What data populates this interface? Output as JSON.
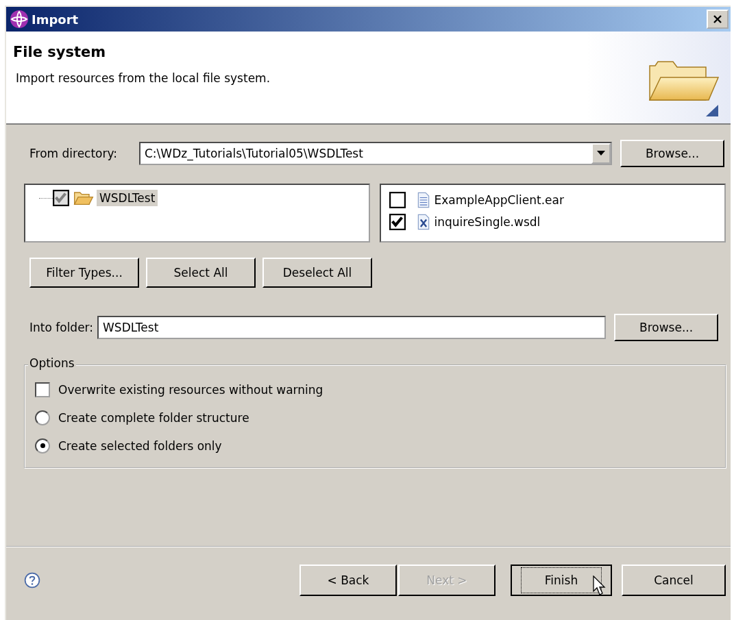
{
  "window": {
    "title": "Import"
  },
  "header": {
    "title": "File system",
    "description": "Import resources from the local file system."
  },
  "from_directory": {
    "label": "From directory:",
    "value": "C:\\WDz_Tutorials\\Tutorial05\\WSDLTest",
    "browse": "Browse..."
  },
  "folder_tree": [
    {
      "label": "WSDLTest",
      "checked": true,
      "grayed": true,
      "selected": true
    }
  ],
  "file_list": [
    {
      "label": "ExampleAppClient.ear",
      "checked": false,
      "kind": "text"
    },
    {
      "label": "inquireSingle.wsdl",
      "checked": true,
      "kind": "xml"
    }
  ],
  "selection_buttons": [
    "Filter Types...",
    "Select All",
    "Deselect All"
  ],
  "into_folder": {
    "label": "Into folder:",
    "value": "WSDLTest",
    "browse": "Browse..."
  },
  "options": {
    "title": "Options",
    "items": [
      {
        "kind": "checkbox",
        "label": "Overwrite existing resources without warning",
        "checked": false
      },
      {
        "kind": "radio",
        "label": "Create complete folder structure",
        "selected": false
      },
      {
        "kind": "radio",
        "label": "Create selected folders only",
        "selected": true
      }
    ]
  },
  "footer_buttons": [
    {
      "label": "< Back",
      "disabled": false,
      "default": false
    },
    {
      "label": "Next >",
      "disabled": true,
      "default": false
    },
    {
      "label": "Finish",
      "disabled": false,
      "default": true
    },
    {
      "label": "Cancel",
      "disabled": false,
      "default": false
    }
  ]
}
